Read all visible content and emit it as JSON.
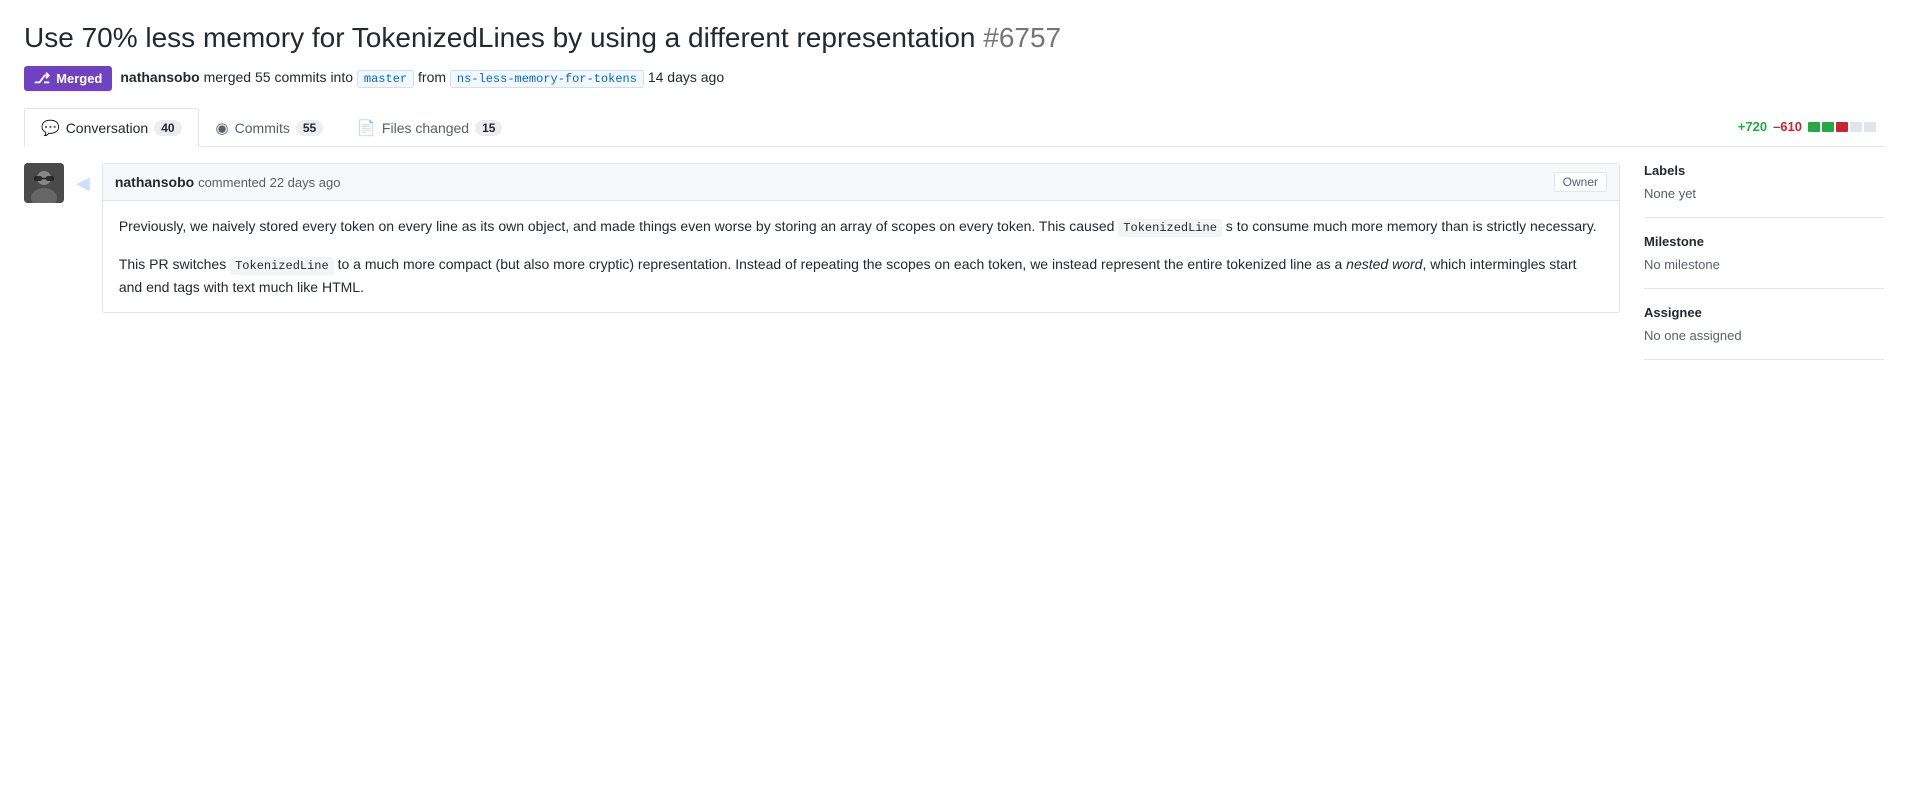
{
  "page": {
    "title": "Use 70% less memory for TokenizedLines by using a different representation",
    "pr_number": "#6757",
    "status": {
      "label": "Merged",
      "icon": "⎇"
    },
    "meta": {
      "author": "nathansobo",
      "action": "merged",
      "commit_count": "55",
      "commit_word": "commits",
      "into_word": "into",
      "base_branch": "master",
      "from_word": "from",
      "head_branch": "ns-less-memory-for-tokens",
      "time_ago": "14 days ago"
    },
    "tabs": [
      {
        "id": "conversation",
        "icon": "💬",
        "label": "Conversation",
        "count": "40",
        "active": true
      },
      {
        "id": "commits",
        "icon": "◉",
        "label": "Commits",
        "count": "55",
        "active": false
      },
      {
        "id": "files",
        "icon": "📄",
        "label": "Files changed",
        "count": "15",
        "active": false
      }
    ],
    "diff_stats": {
      "additions": "+720",
      "deletions": "–610",
      "bar": [
        {
          "type": "add"
        },
        {
          "type": "add"
        },
        {
          "type": "del"
        },
        {
          "type": "neutral"
        },
        {
          "type": "neutral"
        }
      ]
    },
    "comment": {
      "author": "nathansobo",
      "time_ago": "commented 22 days ago",
      "role": "Owner",
      "body_p1": "Previously, we naively stored every token on every line as its own object, and made things even worse by storing an array of scopes on every token. This caused ",
      "inline1": "TokenizedLine",
      "body_p1b": " s to consume much more memory than is strictly necessary.",
      "body_p2_start": "This PR switches ",
      "inline2": "TokenizedLine",
      "body_p2_mid": " to a much more compact (but also more cryptic) representation. Instead of repeating the scopes on each token, we instead represent the entire tokenized line as a ",
      "italic1": "nested word",
      "body_p2_end": ", which intermingles start and end tags with text much like HTML."
    },
    "sidebar": {
      "labels_title": "Labels",
      "labels_value": "None yet",
      "milestone_title": "Milestone",
      "milestone_value": "No milestone",
      "assignee_title": "Assignee",
      "assignee_value": "No one assigned"
    }
  }
}
